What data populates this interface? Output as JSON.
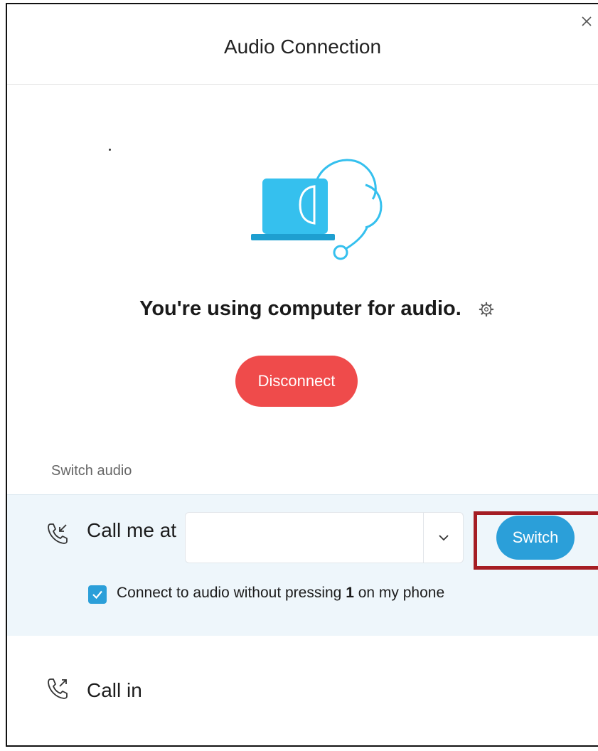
{
  "dialog": {
    "title": "Audio Connection",
    "close_icon": "close-icon"
  },
  "status": {
    "text": "You're using computer for audio.",
    "settings_icon": "gear-icon"
  },
  "disconnect": {
    "label": "Disconnect",
    "color": "#ef4b4b"
  },
  "switch_audio": {
    "section_label": "Switch audio",
    "call_me": {
      "icon": "phone-incoming-icon",
      "label": "Call me at",
      "phone_value": "",
      "dropdown_icon": "chevron-down-icon",
      "switch_label": "Switch",
      "switch_color": "#2b9fd9",
      "checkbox_checked": true,
      "checkbox_text_before": "Connect to audio without pressing ",
      "checkbox_text_key": "1",
      "checkbox_text_after": " on my phone"
    },
    "call_in": {
      "icon": "phone-outgoing-icon",
      "label": "Call in"
    }
  },
  "colors": {
    "illustration": "#35c0ee",
    "panel_background": "#eef6fb",
    "highlight": "#a51d24"
  }
}
